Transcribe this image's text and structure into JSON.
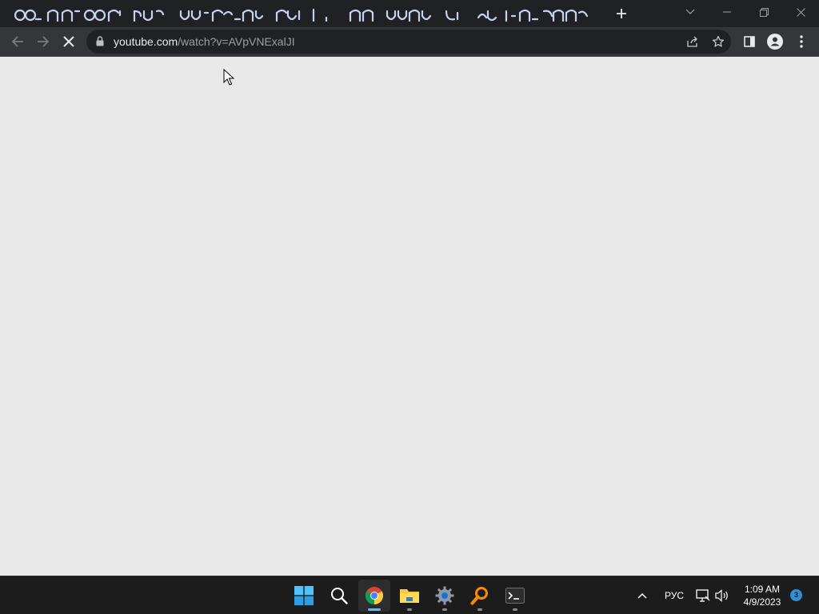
{
  "browser": {
    "tab": {
      "title": ""
    },
    "new_tab_icon": "plus-icon",
    "window_controls": [
      "chevron-down-icon",
      "minimize-icon",
      "restore-icon",
      "close-icon"
    ],
    "nav": {
      "back_icon": "arrow-left-icon",
      "forward_icon": "arrow-right-icon",
      "reload_icon": "stop-loading-icon"
    },
    "omnibox": {
      "url_host": "youtube.com",
      "url_path": "/watch?v=AVpVNExalJI",
      "lock_icon": "lock-icon",
      "share_icon": "share-icon",
      "bookmark_icon": "star-icon"
    },
    "side_panel_icon": "side-panel-icon",
    "profile_icon": "profile-icon",
    "menu_icon": "kebab-menu-icon"
  },
  "page": {
    "state": "loading",
    "background": "#e9e9e9"
  },
  "taskbar": {
    "apps": [
      {
        "name": "start",
        "icon": "windows-start-icon",
        "running": false
      },
      {
        "name": "search",
        "icon": "search-icon",
        "running": false
      },
      {
        "name": "chrome",
        "icon": "chrome-icon",
        "running": true,
        "active": true
      },
      {
        "name": "file-explorer",
        "icon": "folder-icon",
        "running": true
      },
      {
        "name": "settings",
        "icon": "gear-icon",
        "running": true
      },
      {
        "name": "search-tool",
        "icon": "magnifier-orange-icon",
        "running": true
      },
      {
        "name": "terminal",
        "icon": "terminal-icon",
        "running": true
      }
    ],
    "tray": {
      "overflow_icon": "chevron-up-icon",
      "language": "РУС",
      "network_icon": "network-icon",
      "volume_icon": "speaker-icon",
      "time": "1:09 AM",
      "date": "4/9/2023",
      "notification_count": "3"
    }
  },
  "colors": {
    "tabstrip": "#202124",
    "toolbar": "#35363a",
    "omnibox": "#202124",
    "accent": "#4cc2ff",
    "taskbar": "#1c1c1c"
  }
}
